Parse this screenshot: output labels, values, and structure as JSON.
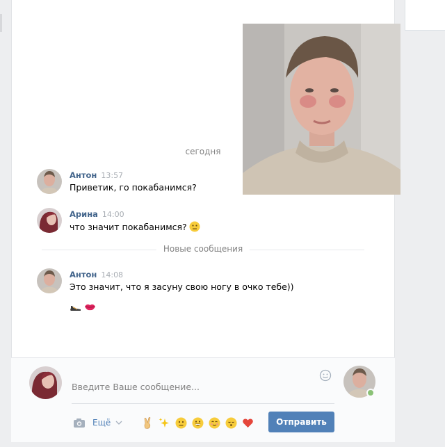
{
  "date_separator": "сегодня",
  "new_messages_separator": "Новые сообщения",
  "messages": [
    {
      "author": "Антон",
      "time": "13:57",
      "text": "Приветик, го покабанимся?"
    },
    {
      "author": "Арина",
      "time": "14:00",
      "text": "что значит покабанимся?"
    },
    {
      "author": "Антон",
      "time": "14:08",
      "text": "Это значит, что я засуну свою ногу в очко тебе))"
    }
  ],
  "composer": {
    "placeholder": "Введите Ваше сообщение...",
    "more_label": "Ещё",
    "send_label": "Отправить"
  },
  "icons": {
    "emoji_meh": "neutral-face-emoji",
    "stickers": [
      "high-heel-shoe-icon",
      "kiss-lips-icon"
    ],
    "quick_emojis": [
      "victory-hand-icon",
      "sparkles-icon",
      "neutral-face-icon",
      "grinning-face-icon",
      "relieved-face-icon",
      "kissing-face-icon",
      "red-heart-icon"
    ]
  },
  "colors": {
    "author_link": "#42648b",
    "accent": "#5181b8",
    "online": "#8ac176"
  }
}
